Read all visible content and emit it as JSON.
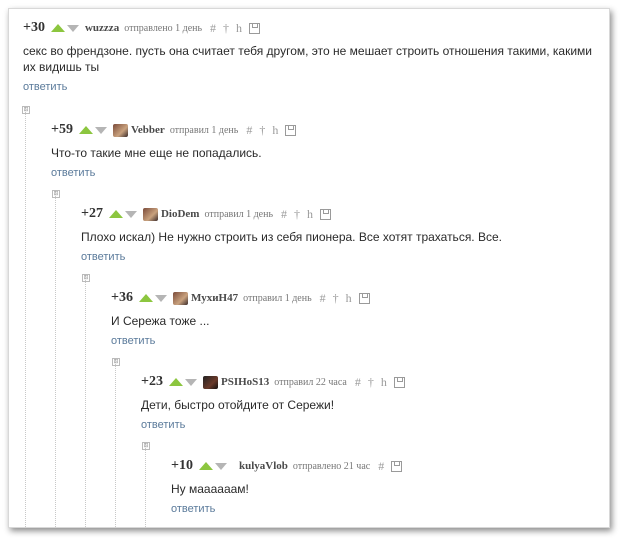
{
  "comments": [
    {
      "score": "+30",
      "author": "wuzzza",
      "meta": "отправлено 1 день",
      "text": "секс во френдзоне. пусть она считает тебя другом, это не мешает строить отношения такими, какими их видишь ты",
      "reply": "ответить",
      "tools": [
        "#",
        "†",
        "h"
      ]
    },
    {
      "score": "+59",
      "author": "Vebber",
      "meta": "отправил 1 день",
      "text": "Что-то такие мне еще не попадались.",
      "reply": "ответить",
      "tools": [
        "#",
        "†",
        "h"
      ]
    },
    {
      "score": "+27",
      "author": "DioDem",
      "meta": "отправил 1 день",
      "text": "Плохо искал) Не нужно строить из себя пионера. Все хотят трахаться. Все.",
      "reply": "ответить",
      "tools": [
        "#",
        "†",
        "h"
      ]
    },
    {
      "score": "+36",
      "author": "МухиН47",
      "meta": "отправил 1 день",
      "text": "И Сережа тоже ...",
      "reply": "ответить",
      "tools": [
        "#",
        "†",
        "h"
      ]
    },
    {
      "score": "+23",
      "author": "PSIHoS13",
      "meta": "отправил 22 часа",
      "text": "Дети, быстро отойдите от Сережи!",
      "reply": "ответить",
      "tools": [
        "#",
        "†",
        "h"
      ]
    },
    {
      "score": "+10",
      "author": "kulyaVlob",
      "meta": "отправлено 21 час",
      "text": "Ну маааааам!",
      "reply": "ответить",
      "tools": [
        "#"
      ]
    }
  ],
  "collapse_symbol": "⊟",
  "colors": {
    "upvote": "#8cc63f",
    "downvote": "#b5b5b5",
    "link": "#5a7a9a"
  }
}
